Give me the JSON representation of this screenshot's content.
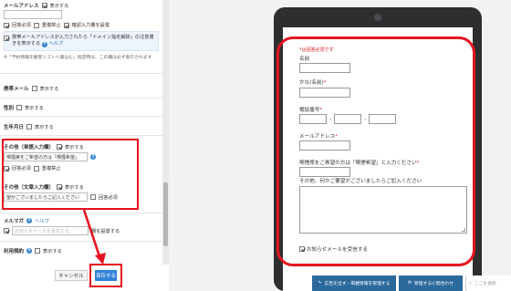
{
  "left_panel": {
    "email": {
      "label": "メールアドレス",
      "show_label": "表示する",
      "required_label": "回答必須",
      "duplicate_label": "重複禁止",
      "confirm_label": "確認入力欄を設置",
      "domain_note": "携帯メールアドレスが入力されたら「ドメイン指定解除」の注意書きを表示する",
      "help_link": "ヘルプ",
      "footnote": "※「予約情報を顧客リストへ書込む」指定時は、この欄は必ず表示されます"
    },
    "mobile_email": {
      "label": "携帯メール",
      "show_label": "表示する"
    },
    "gender": {
      "label": "性別",
      "show_label": "表示する"
    },
    "birthday": {
      "label": "生年月日",
      "show_label": "表示する"
    },
    "other_single": {
      "label": "その他（単語入力欄）",
      "show_label": "表示する",
      "value": "喫煙席をご希望の方は「喫煙希望」",
      "required_label": "回答必須",
      "duplicate_label": "重複禁止"
    },
    "other_text": {
      "label": "その他（文章入力欄）",
      "show_label": "表示する",
      "value": "望がございましたらご記入ください",
      "required_label": "回答必須"
    },
    "magazine": {
      "label": "メルマガ",
      "help_link": "ヘルプ",
      "placeholder": "お知らせメールを受信する",
      "suffix": "欄を設置する"
    },
    "terms": {
      "label": "利用規約",
      "show_label": "表示する"
    },
    "cancel_button": "キャンセル",
    "save_button": "保存する"
  },
  "preview": {
    "required_note": "*は回答必須です",
    "name_label": "名前",
    "kana_label": "かな(名前)",
    "phone_label": "電話番号",
    "phone_sep": "-",
    "email_label": "メールアドレス",
    "smoking_label": "喫煙席をご希望の方は「喫煙希望」と入力ください",
    "other_label": "その他、何かご要望がございましたらご記入ください",
    "magazine_label": "お知らせメールを受信する",
    "required_mark": "*"
  },
  "bottom_bar": {
    "ad_button": "広告を出す - 掲載情報を管理する",
    "inquiry_button": "管理するに問合わせ",
    "search_placeholder": "ここを検索"
  },
  "colors": {
    "highlight": "#e4131f",
    "primary": "#2f82d8",
    "tablet": "#2e2e30"
  }
}
